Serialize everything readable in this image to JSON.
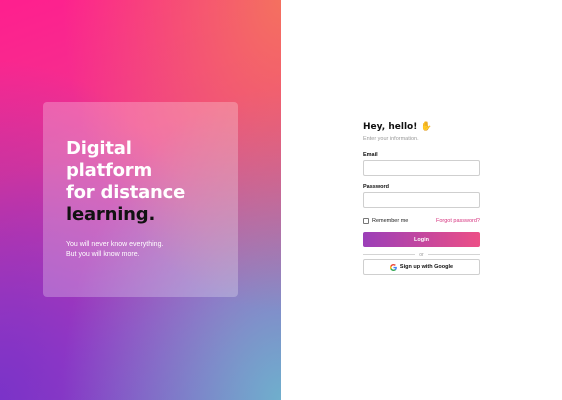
{
  "hero": {
    "headline_lines": [
      "Digital",
      "platform",
      "for distance"
    ],
    "headline_emphasis": "learning.",
    "subtext_lines": [
      "You will never know everything.",
      "But you will know more."
    ]
  },
  "form": {
    "greeting": "Hey, hello!",
    "greeting_icon": "waving-hand-icon",
    "instruction": "Enter your information.",
    "email_label": "Email",
    "email_value": "",
    "password_label": "Password",
    "password_value": "",
    "remember_label": "Remember me",
    "remember_checked": false,
    "forgot_label": "Forgot password?",
    "login_label": "Login",
    "divider_label": "or",
    "google_label": "Sign up with Google",
    "google_icon": "google-icon"
  },
  "colors": {
    "accent": "#d6337f",
    "button_gradient_start": "#9b3fb8",
    "button_gradient_end": "#ec4f86"
  }
}
